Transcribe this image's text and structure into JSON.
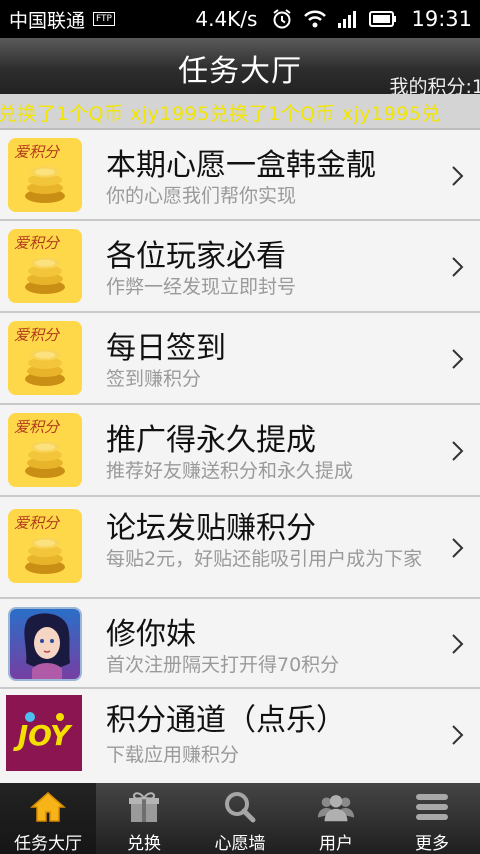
{
  "status_bar": {
    "carrier": "中国联通",
    "ftp_badge": "FTP",
    "speed": "4.4K/s",
    "time": "19:31",
    "icons": [
      "alarm-icon",
      "wifi-icon",
      "signal-icon",
      "battery-icon"
    ]
  },
  "header": {
    "title": "任务大厅",
    "points_label": "我的积分:1"
  },
  "marquee": {
    "text": "兑换了1个Q币    xjy1995兑换了1个Q币    xjy1995兑"
  },
  "tasks": [
    {
      "title": "本期心愿一盒韩金靓",
      "subtitle": "你的心愿我们帮你实现",
      "icon": "coins-icon"
    },
    {
      "title": "各位玩家必看",
      "subtitle": "作弊一经发现立即封号",
      "icon": "coins-icon"
    },
    {
      "title": "每日签到",
      "subtitle": "签到赚积分",
      "icon": "coins-icon"
    },
    {
      "title": "推广得永久提成",
      "subtitle": "推荐好友赚送积分和永久提成",
      "icon": "coins-icon"
    },
    {
      "title": "论坛发贴赚积分",
      "subtitle": "每贴2元，好贴还能吸引用户成为下家",
      "icon": "coins-icon"
    },
    {
      "title": "修你妹",
      "subtitle": "首次注册隔天打开得70积分",
      "icon": "game-avatar-icon"
    },
    {
      "title": "积分通道（点乐）",
      "subtitle": "下载应用赚积分",
      "icon": "joy-logo-icon"
    }
  ],
  "coin_icon_text": "爱积分",
  "joy_logo_text": "JOY",
  "bottom_nav": [
    {
      "label": "任务大厅",
      "icon": "home-icon",
      "active": true
    },
    {
      "label": "兑换",
      "icon": "gift-icon",
      "active": false
    },
    {
      "label": "心愿墙",
      "icon": "search-icon",
      "active": false
    },
    {
      "label": "用户",
      "icon": "users-icon",
      "active": false
    },
    {
      "label": "更多",
      "icon": "menu-icon",
      "active": false
    }
  ]
}
